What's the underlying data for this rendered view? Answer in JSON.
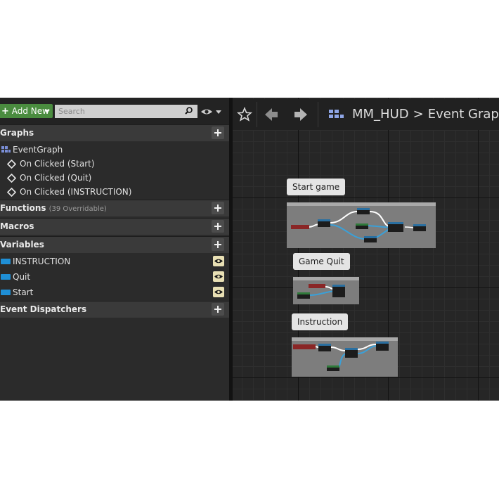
{
  "left_panel": {
    "add_new_label": "Add New",
    "search_placeholder": "Search",
    "sections": {
      "graphs": "Graphs",
      "functions": "Functions",
      "functions_sub": "(39 Overridable)",
      "macros": "Macros",
      "variables": "Variables",
      "event_dispatchers": "Event Dispatchers"
    },
    "graph_items": [
      "EventGraph",
      "On Clicked (Start)",
      "On Clicked (Quit)",
      "On Clicked (INSTRUCTION)"
    ],
    "variable_items": [
      "INSTRUCTION",
      "Quit",
      "Start"
    ]
  },
  "graph_editor": {
    "breadcrumb_blueprint": "MM_HUD",
    "breadcrumb_separator": ">",
    "breadcrumb_graph": "Event Graph",
    "comments": [
      "Start game",
      "Game Quit",
      "Instruction"
    ]
  },
  "colors": {
    "accent_green": "#4a8c3f",
    "variable_blue": "#1f8fd6",
    "wire_blue": "#3aa0d8",
    "wire_white": "#ffffff"
  },
  "icons": [
    "add-icon",
    "search-icon",
    "eye-icon",
    "graph-grid-icon",
    "event-diamond-icon",
    "variable-icon",
    "star-icon",
    "back-arrow-icon",
    "forward-arrow-icon",
    "blueprint-icon"
  ]
}
